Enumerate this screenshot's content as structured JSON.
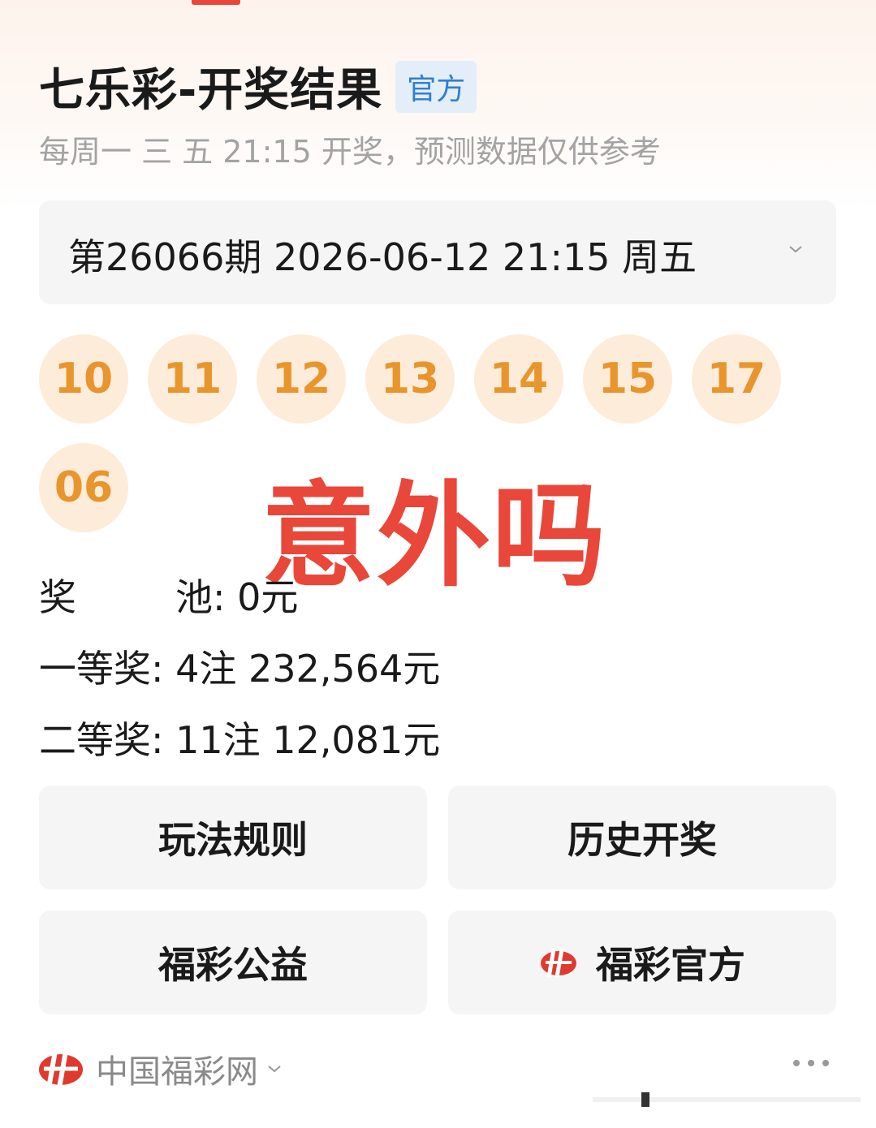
{
  "header": {
    "title": "七乐彩-开奖结果",
    "badge": "官方",
    "subtitle": "每周一 三 五 21:15 开奖，预测数据仅供参考"
  },
  "issue_select": {
    "value": "第26066期 2026-06-12 21:15 周五",
    "icon": "chevron-down-icon"
  },
  "balls": {
    "main": [
      "10",
      "11",
      "12",
      "13",
      "14",
      "15",
      "17"
    ],
    "special": "06",
    "color": "#e8952d",
    "bg_color": "#fdecd9"
  },
  "overlay_text": "意外吗",
  "prizes": {
    "pool_label_a": "奖",
    "pool_label_b": "池:",
    "pool_value": "0元",
    "first_label": "一等奖:",
    "first_value": "4注 232,564元",
    "second_label": "二等奖:",
    "second_value": "11注 12,081元"
  },
  "buttons": {
    "rules": "玩法规则",
    "history": "历史开奖",
    "charity": "福彩公益",
    "official": "福彩官方"
  },
  "footer": {
    "source": "中国福彩网",
    "icon": "fucai-logo-icon",
    "more_icon": "more-icon"
  },
  "colors": {
    "accent": "#e8473a",
    "badge_blue": "#2f7fd1"
  }
}
